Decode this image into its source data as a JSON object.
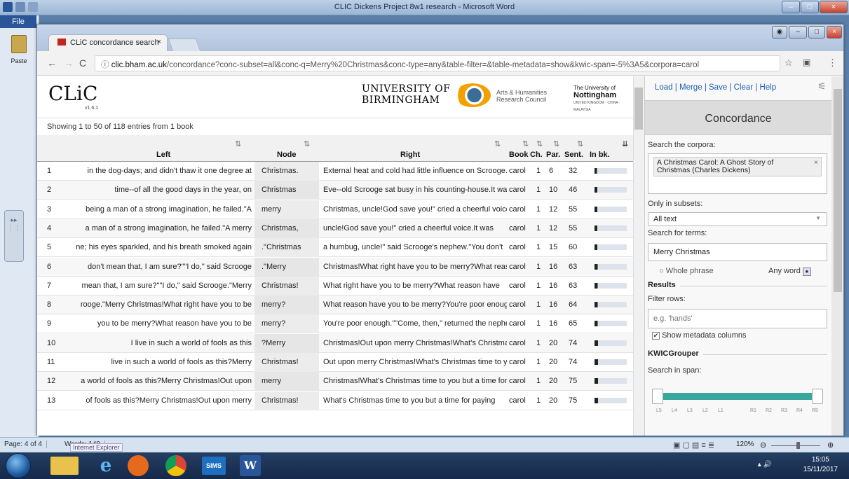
{
  "word": {
    "title": "CLIC Dickens Project 8w1 research  -  Microsoft Word",
    "file_tab": "File",
    "paste_label": "Paste",
    "status_page": "Page: 4 of 4",
    "status_words": "Words: 149",
    "zoom": "120%",
    "taskbar_tooltip": "Internet Explorer"
  },
  "taskbar": {
    "items": [
      "explorer",
      "internet-explorer",
      "media-player",
      "chrome",
      "SIMS",
      "word"
    ],
    "sims_label": "SIMS",
    "time": "15:05",
    "date": "15/11/2017"
  },
  "browser": {
    "tab_title": "CLiC concordance search",
    "tab_close": "×",
    "url_host": "clic.bham.ac.uk",
    "url_path": "/concordance?conc-subset=all&conc-q=Merry%20Christmas&conc-type=any&table-filter=&table-metadata=show&kwic-span=-5%3A5&corpora=carol"
  },
  "header": {
    "logo": "CLiC",
    "version": "v1.6.1",
    "uob_line1": "UNIVERSITY OF",
    "uob_line2": "BIRMINGHAM",
    "ahrc_line1": "Arts & Humanities",
    "ahrc_line2": "Research Council",
    "uon_line1": "The University of",
    "uon_line2": "Nottingham",
    "uon_line3": "UNITED KINGDOM · CHINA · MALAYSIA"
  },
  "results": {
    "count_text": "Showing 1 to 50 of 118 entries from 1 book",
    "columns": {
      "left": "Left",
      "node": "Node",
      "right": "Right",
      "book": "Book",
      "ch": "Ch.",
      "par": "Par.",
      "sent": "Sent.",
      "inbk": "In bk."
    },
    "rows": [
      {
        "n": "1",
        "left": "in the dog-days; and didn't thaw it one degree at",
        "node": "Christmas.",
        "right": "External heat and cold had little influence on Scrooge.",
        "book": "carol",
        "ch": "1",
        "par": "6",
        "sent": "32",
        "pos": 0.03
      },
      {
        "n": "2",
        "left": "time--of all the good days in the year, on",
        "node": "Christmas",
        "right": "Eve--old Scrooge sat busy in his counting-house.It was",
        "book": "carol",
        "ch": "1",
        "par": "10",
        "sent": "46",
        "pos": 0.04
      },
      {
        "n": "3",
        "left": "being a man of a strong imagination, he failed.\"A",
        "node": "merry",
        "right": "Christmas, uncle!God save you!\" cried a cheerful voice.",
        "book": "carol",
        "ch": "1",
        "par": "12",
        "sent": "55",
        "pos": 0.05
      },
      {
        "n": "4",
        "left": "a man of a strong imagination, he failed.\"A merry",
        "node": "Christmas,",
        "right": "uncle!God save you!\" cried a cheerful voice.It was",
        "book": "carol",
        "ch": "1",
        "par": "12",
        "sent": "55",
        "pos": 0.05
      },
      {
        "n": "5",
        "left": "ne; his eyes sparkled, and his breath smoked again",
        "node": ".\"Christmas",
        "right": "a humbug, uncle!\" said Scrooge's nephew.\"You don't",
        "book": "carol",
        "ch": "1",
        "par": "15",
        "sent": "60",
        "pos": 0.05
      },
      {
        "n": "6",
        "left": "don't mean that, I am sure?\"\"I do,\" said Scrooge",
        "node": ".\"Merry",
        "right": "Christmas!What right have you to be merry?What reason",
        "book": "carol",
        "ch": "1",
        "par": "16",
        "sent": "63",
        "pos": 0.06
      },
      {
        "n": "7",
        "left": "mean that, I am sure?\"\"I do,\" said Scrooge.\"Merry",
        "node": "Christmas!",
        "right": "What right have you to be merry?What reason have",
        "book": "carol",
        "ch": "1",
        "par": "16",
        "sent": "63",
        "pos": 0.06
      },
      {
        "n": "8",
        "left": "rooge.\"Merry Christmas!What right have you to be",
        "node": "merry?",
        "right": "What reason have you to be merry?You're poor enough.",
        "book": "carol",
        "ch": "1",
        "par": "16",
        "sent": "64",
        "pos": 0.06
      },
      {
        "n": "9",
        "left": "you to be merry?What reason have you to be",
        "node": "merry?",
        "right": "You're poor enough.\"\"Come, then,\" returned the nephew",
        "book": "carol",
        "ch": "1",
        "par": "16",
        "sent": "65",
        "pos": 0.06
      },
      {
        "n": "10",
        "left": "I live in such a world of fools as this",
        "node": "?Merry",
        "right": "Christmas!Out upon merry Christmas!What's Christmas",
        "book": "carol",
        "ch": "1",
        "par": "20",
        "sent": "74",
        "pos": 0.07
      },
      {
        "n": "11",
        "left": "live in such a world of fools as this?Merry",
        "node": "Christmas!",
        "right": "Out upon merry Christmas!What's Christmas time to you",
        "book": "carol",
        "ch": "1",
        "par": "20",
        "sent": "74",
        "pos": 0.07
      },
      {
        "n": "12",
        "left": "a world of fools as this?Merry Christmas!Out upon",
        "node": "merry",
        "right": "Christmas!What's Christmas time to you but a time for",
        "book": "carol",
        "ch": "1",
        "par": "20",
        "sent": "75",
        "pos": 0.07
      },
      {
        "n": "13",
        "left": "of fools as this?Merry Christmas!Out upon merry",
        "node": "Christmas!",
        "right": "What's Christmas time to you but a time for paying",
        "book": "carol",
        "ch": "1",
        "par": "20",
        "sent": "75",
        "pos": 0.07
      }
    ]
  },
  "panel": {
    "menu": {
      "load": "Load",
      "merge": "Merge",
      "save": "Save",
      "clear": "Clear",
      "help": "Help",
      "sep": "|"
    },
    "title": "Concordance",
    "search_corpora_label": "Search the corpora:",
    "corpus_tag": "A Christmas Carol: A Ghost Story of Christmas (Charles Dickens)",
    "corpus_remove": "×",
    "subsets_label": "Only in subsets:",
    "subset_value": "All text",
    "terms_label": "Search for terms:",
    "terms_value": "Merry Christmas",
    "whole_phrase": "Whole phrase",
    "any_word": "Any word",
    "results_heading": "Results",
    "filter_label": "Filter rows:",
    "filter_placeholder": "e.g. 'hands'",
    "show_metadata": "Show metadata columns",
    "kwic_heading": "KWICGrouper",
    "span_label": "Search in span:",
    "span_ticks": [
      "L5",
      "L4",
      "L3",
      "L2",
      "L1",
      "R1",
      "R2",
      "R3",
      "R4",
      "R5"
    ]
  },
  "colors": {
    "accent": "#37a89c",
    "link": "#1f5fae",
    "word_blue": "#2a5699"
  }
}
